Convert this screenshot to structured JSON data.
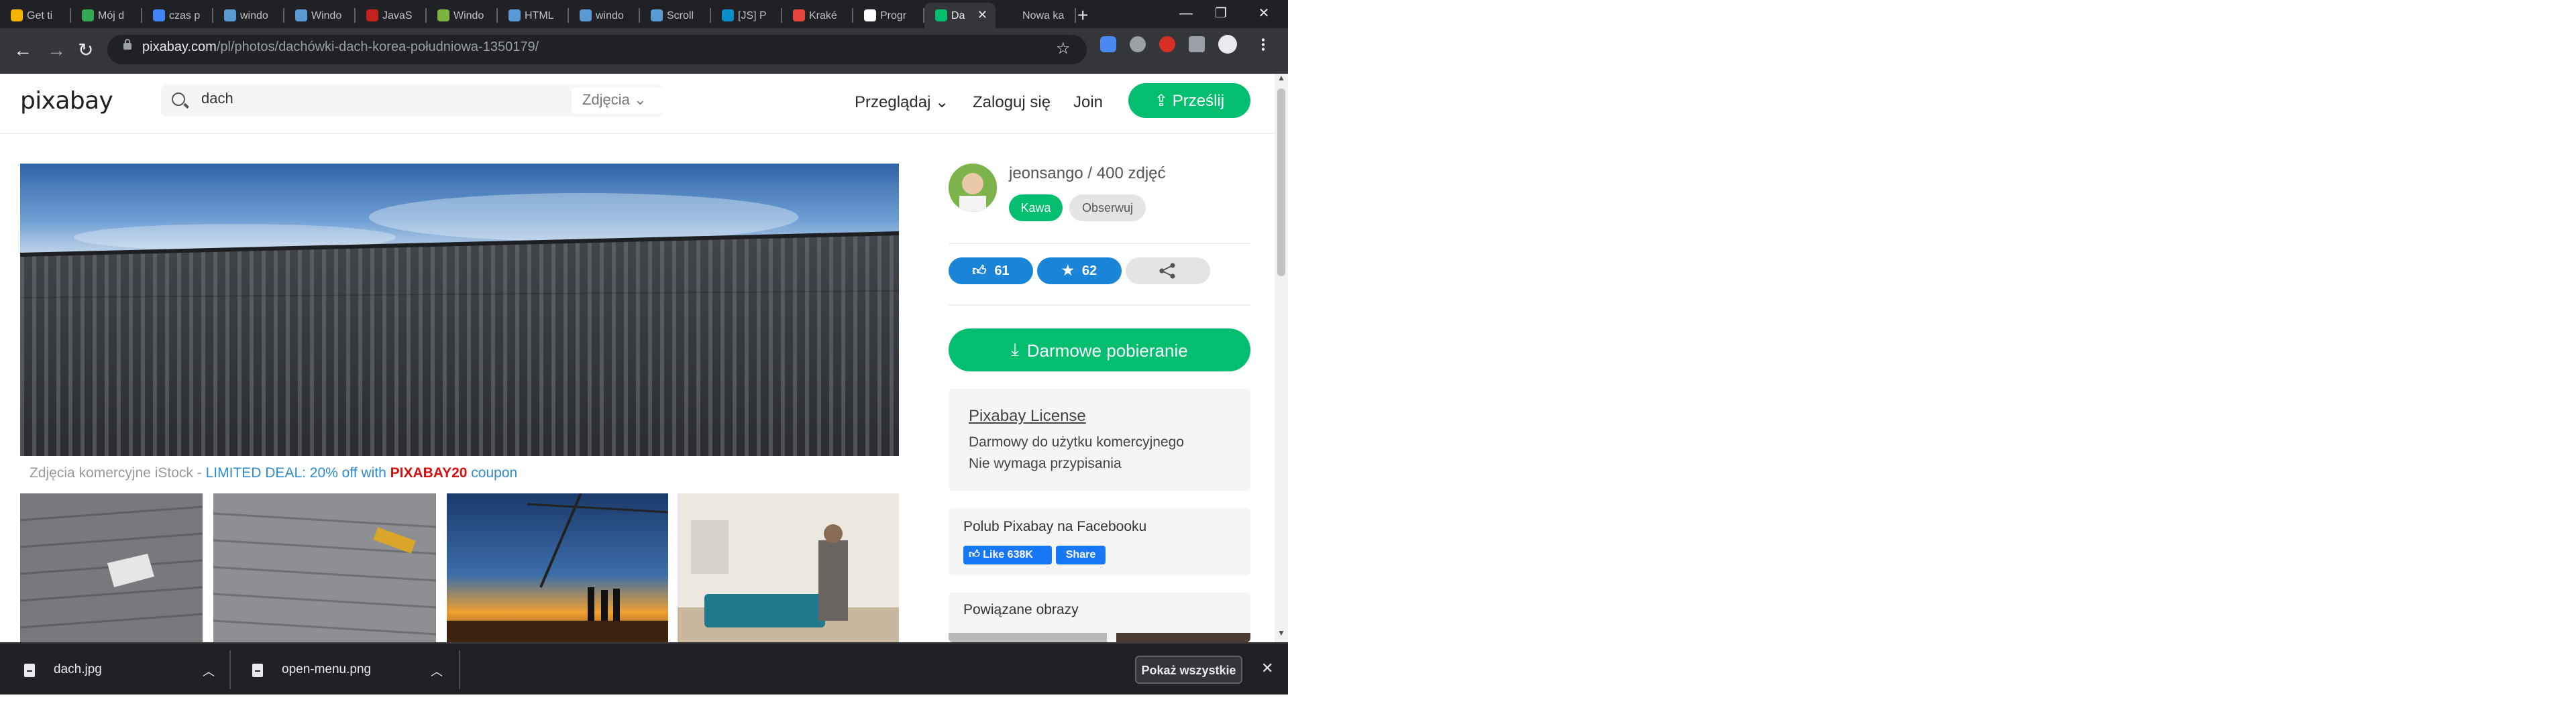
{
  "browser": {
    "tabs": [
      {
        "label": "Get ti",
        "color": "#f4b400"
      },
      {
        "label": "Mój d",
        "color": "#34a853"
      },
      {
        "label": "czas p",
        "color": "#4285f4"
      },
      {
        "label": "windo",
        "color": "#5b9bd5"
      },
      {
        "label": "Windo",
        "color": "#5b9bd5"
      },
      {
        "label": "JavaS",
        "color": "#c5221f"
      },
      {
        "label": "Windo",
        "color": "#7cb342"
      },
      {
        "label": "HTML",
        "color": "#5b9bd5"
      },
      {
        "label": "windo",
        "color": "#5b9bd5"
      },
      {
        "label": "Scroll",
        "color": "#5b9bd5"
      },
      {
        "label": "[JS] P",
        "color": "#0b8fc9"
      },
      {
        "label": "Kraké",
        "color": "#e8453c"
      },
      {
        "label": "Progr",
        "color": "#ffffff"
      },
      {
        "label": "Da",
        "color": "#02be6e"
      },
      {
        "label": "Nowa ka",
        "color": "#202124"
      }
    ],
    "active_tab_index": 13,
    "new_tab": "+",
    "window_controls": {
      "minimize": "—",
      "restore": "❐",
      "close": "✕"
    },
    "nav": {
      "back": "←",
      "forward": "→",
      "reload": "↻"
    },
    "url_host": "pixabay.com",
    "url_path": "/pl/photos/dachówki-dach-korea-południowa-1350179/",
    "star": "☆"
  },
  "site": {
    "logo": "pixabay",
    "search": {
      "value": "dach",
      "type": "Zdjęcia"
    },
    "nav": {
      "browse": "Przeglądaj",
      "login": "Zaloguj się",
      "join": "Join",
      "upload": "Prześlij"
    }
  },
  "ad": {
    "prefix": "Zdjęcia komercyjne iStock - ",
    "deal": "LIMITED DEAL: 20% off with ",
    "code": "PIXABAY20",
    "suffix": " coupon"
  },
  "sidebar": {
    "author": "jeonsango / 400 zdjęć",
    "coffee": "Kawa",
    "follow": "Obserwuj",
    "likes": "61",
    "favorites": "62",
    "download": "Darmowe pobieranie",
    "license": {
      "title": "Pixabay License",
      "line1": "Darmowy do użytku komercyjnego",
      "line2": "Nie wymaga przypisania"
    },
    "facebook": {
      "title": "Polub Pixabay na Facebooku",
      "like": "Like 638K",
      "share": "Share"
    },
    "related": "Powiązane obrazy"
  },
  "downloads": {
    "items": [
      "dach.jpg",
      "open-menu.png"
    ],
    "show_all": "Pokaż wszystkie",
    "close": "✕"
  },
  "colors": {
    "brand_green": "#02be6e",
    "like_blue": "#1a84d8",
    "ad_red": "#d30f0f",
    "ad_blue": "#2e8bce"
  }
}
